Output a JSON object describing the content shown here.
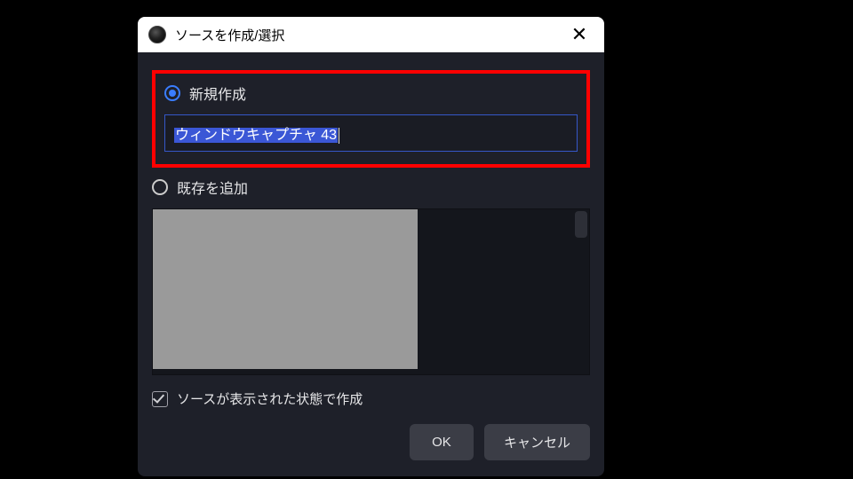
{
  "dialog": {
    "title": "ソースを作成/選択",
    "radio_new_label": "新規作成",
    "radio_existing_label": "既存を追加",
    "input_value": "ウィンドウキャプチャ 43",
    "checkbox_label": "ソースが表示された状態で作成",
    "ok_label": "OK",
    "cancel_label": "キャンセル"
  }
}
